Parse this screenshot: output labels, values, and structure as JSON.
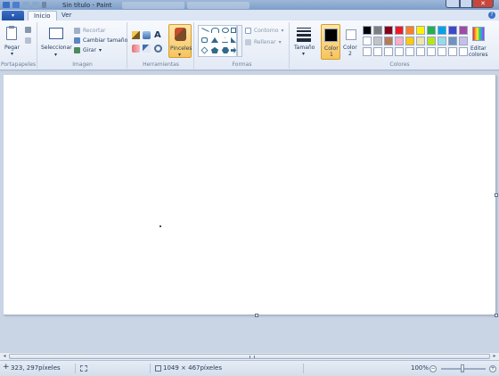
{
  "titlebar": {
    "title": "Sin título - Paint",
    "close_glyph": "✕"
  },
  "menu": {
    "app_button": "▾",
    "tabs": [
      {
        "label": "Inicio",
        "active": true
      },
      {
        "label": "Ver",
        "active": false
      }
    ],
    "help_glyph": "?"
  },
  "ribbon": {
    "clipboard": {
      "group_label": "Portapapeles",
      "paste_label": "Pegar",
      "paste_arrow": "▾"
    },
    "image": {
      "group_label": "Imagen",
      "select_label": "Seleccionar",
      "select_arrow": "▾",
      "crop_label": "Recortar",
      "resize_label": "Cambiar tamaño",
      "rotate_label": "Girar"
    },
    "tools": {
      "group_label": "Herramientas",
      "text_glyph": "A",
      "brushes_label": "Pinceles",
      "brushes_arrow": "▾"
    },
    "shapes": {
      "group_label": "Formas",
      "outline_label": "Contorno",
      "fill_label": "Rellenar"
    },
    "size": {
      "label": "Tamaño",
      "arrow": "▾"
    },
    "colors": {
      "group_label": "Colores",
      "color1_label": "Color",
      "color1_num": "1",
      "color2_label": "Color",
      "color2_num": "2",
      "edit_label_1": "Editar",
      "edit_label_2": "colores",
      "color1": "#000000",
      "color2": "#ffffff",
      "palette": [
        "#000000",
        "#7f7f7f",
        "#880015",
        "#ed1c24",
        "#ff7f27",
        "#fff200",
        "#22b14c",
        "#00a2e8",
        "#3f48cc",
        "#a349a4",
        "#ffffff",
        "#c3c3c3",
        "#b97a57",
        "#ffaec9",
        "#ffc90e",
        "#efe4b0",
        "#b5e61d",
        "#99d9ea",
        "#7092be",
        "#c8bfe7",
        "#ffffff",
        "#ffffff",
        "#ffffff",
        "#ffffff",
        "#ffffff",
        "#ffffff",
        "#ffffff",
        "#ffffff",
        "#ffffff",
        "#ffffff"
      ]
    }
  },
  "statusbar": {
    "cursor_pos": "323, 297píxeles",
    "image_size": "1049 × 467píxeles",
    "zoom": "100%",
    "zoom_out": "−",
    "zoom_in": "+"
  },
  "scroll": {
    "left_arrow": "◂",
    "right_arrow": "▸"
  }
}
